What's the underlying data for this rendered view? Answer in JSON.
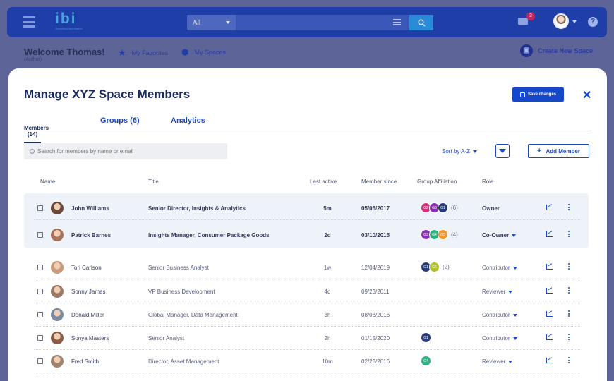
{
  "nav": {
    "logo_text": "ibi",
    "logo_sub": "Unlocking Information",
    "search_scope": "All",
    "search_value": "",
    "mail_badge": "3",
    "help_label": "?"
  },
  "subbar": {
    "welcome": "Welcome Thomas!",
    "role": "(Author)",
    "favorites": "My Favorites",
    "spaces": "My Spaces",
    "create": "Create New Space"
  },
  "modal": {
    "title": "Manage XYZ Space Members",
    "save_label": "Save changes",
    "close_label": "✕",
    "tabs": [
      {
        "label": "Members (14)"
      },
      {
        "label": "Groups (6)"
      },
      {
        "label": "Analytics"
      }
    ],
    "search_placeholder": "Search for members by name or email",
    "sort_label": "Sort by A-Z",
    "add_label": "Add Member",
    "columns": {
      "name": "Name",
      "title": "Title",
      "last_active": "Last active",
      "member_since": "Member since",
      "groups": "Group Affiliation",
      "role": "Role"
    },
    "rows": [
      {
        "name": "John Williams",
        "title": "Senior Director, Insights & Analytics",
        "last_active": "5m",
        "since": "05/05/2017",
        "groups": [
          {
            "label": "G2",
            "color": "#d2307e"
          },
          {
            "label": "G3",
            "color": "#8a2fb2"
          },
          {
            "label": "G1",
            "color": "#273b78"
          }
        ],
        "extra": "(6)",
        "role": "Owner"
      },
      {
        "name": "Patrick Barnes",
        "title": "Insights Manager, Consumer Package Goods",
        "last_active": "2d",
        "since": "03/10/2015",
        "groups": [
          {
            "label": "G3",
            "color": "#8a2fb2"
          },
          {
            "label": "G4",
            "color": "#2fb080"
          },
          {
            "label": "G5",
            "color": "#f0962a"
          }
        ],
        "extra": "(4)",
        "role": "Co-Owner"
      },
      {
        "name": "Tori Carlson",
        "title": "Senior Business Analyst",
        "last_active": "1w",
        "since": "12/04/2019",
        "groups": [
          {
            "label": "G1",
            "color": "#273b78"
          },
          {
            "label": "G6",
            "color": "#b0c224"
          }
        ],
        "extra": "(2)",
        "role": "Contributor"
      },
      {
        "name": "Sonny James",
        "title": "VP Business Development",
        "last_active": "4d",
        "since": "09/23/2011",
        "groups": [],
        "extra": "",
        "role": "Reviewer"
      },
      {
        "name": "Donald Miller",
        "title": "Global Manager, Data Management",
        "last_active": "3h",
        "since": "08/08/2016",
        "groups": [],
        "extra": "",
        "role": "Contributor"
      },
      {
        "name": "Sonya Masters",
        "title": "Senior Analyst",
        "last_active": "2h",
        "since": "01/15/2020",
        "groups": [
          {
            "label": "G1",
            "color": "#273b78"
          }
        ],
        "extra": "",
        "role": "Contributor"
      },
      {
        "name": "Fred Smith",
        "title": "Director, Asset Management",
        "last_active": "10m",
        "since": "02/23/2016",
        "groups": [
          {
            "label": "G4",
            "color": "#2fb080"
          }
        ],
        "extra": "",
        "role": "Reviewer"
      }
    ]
  }
}
